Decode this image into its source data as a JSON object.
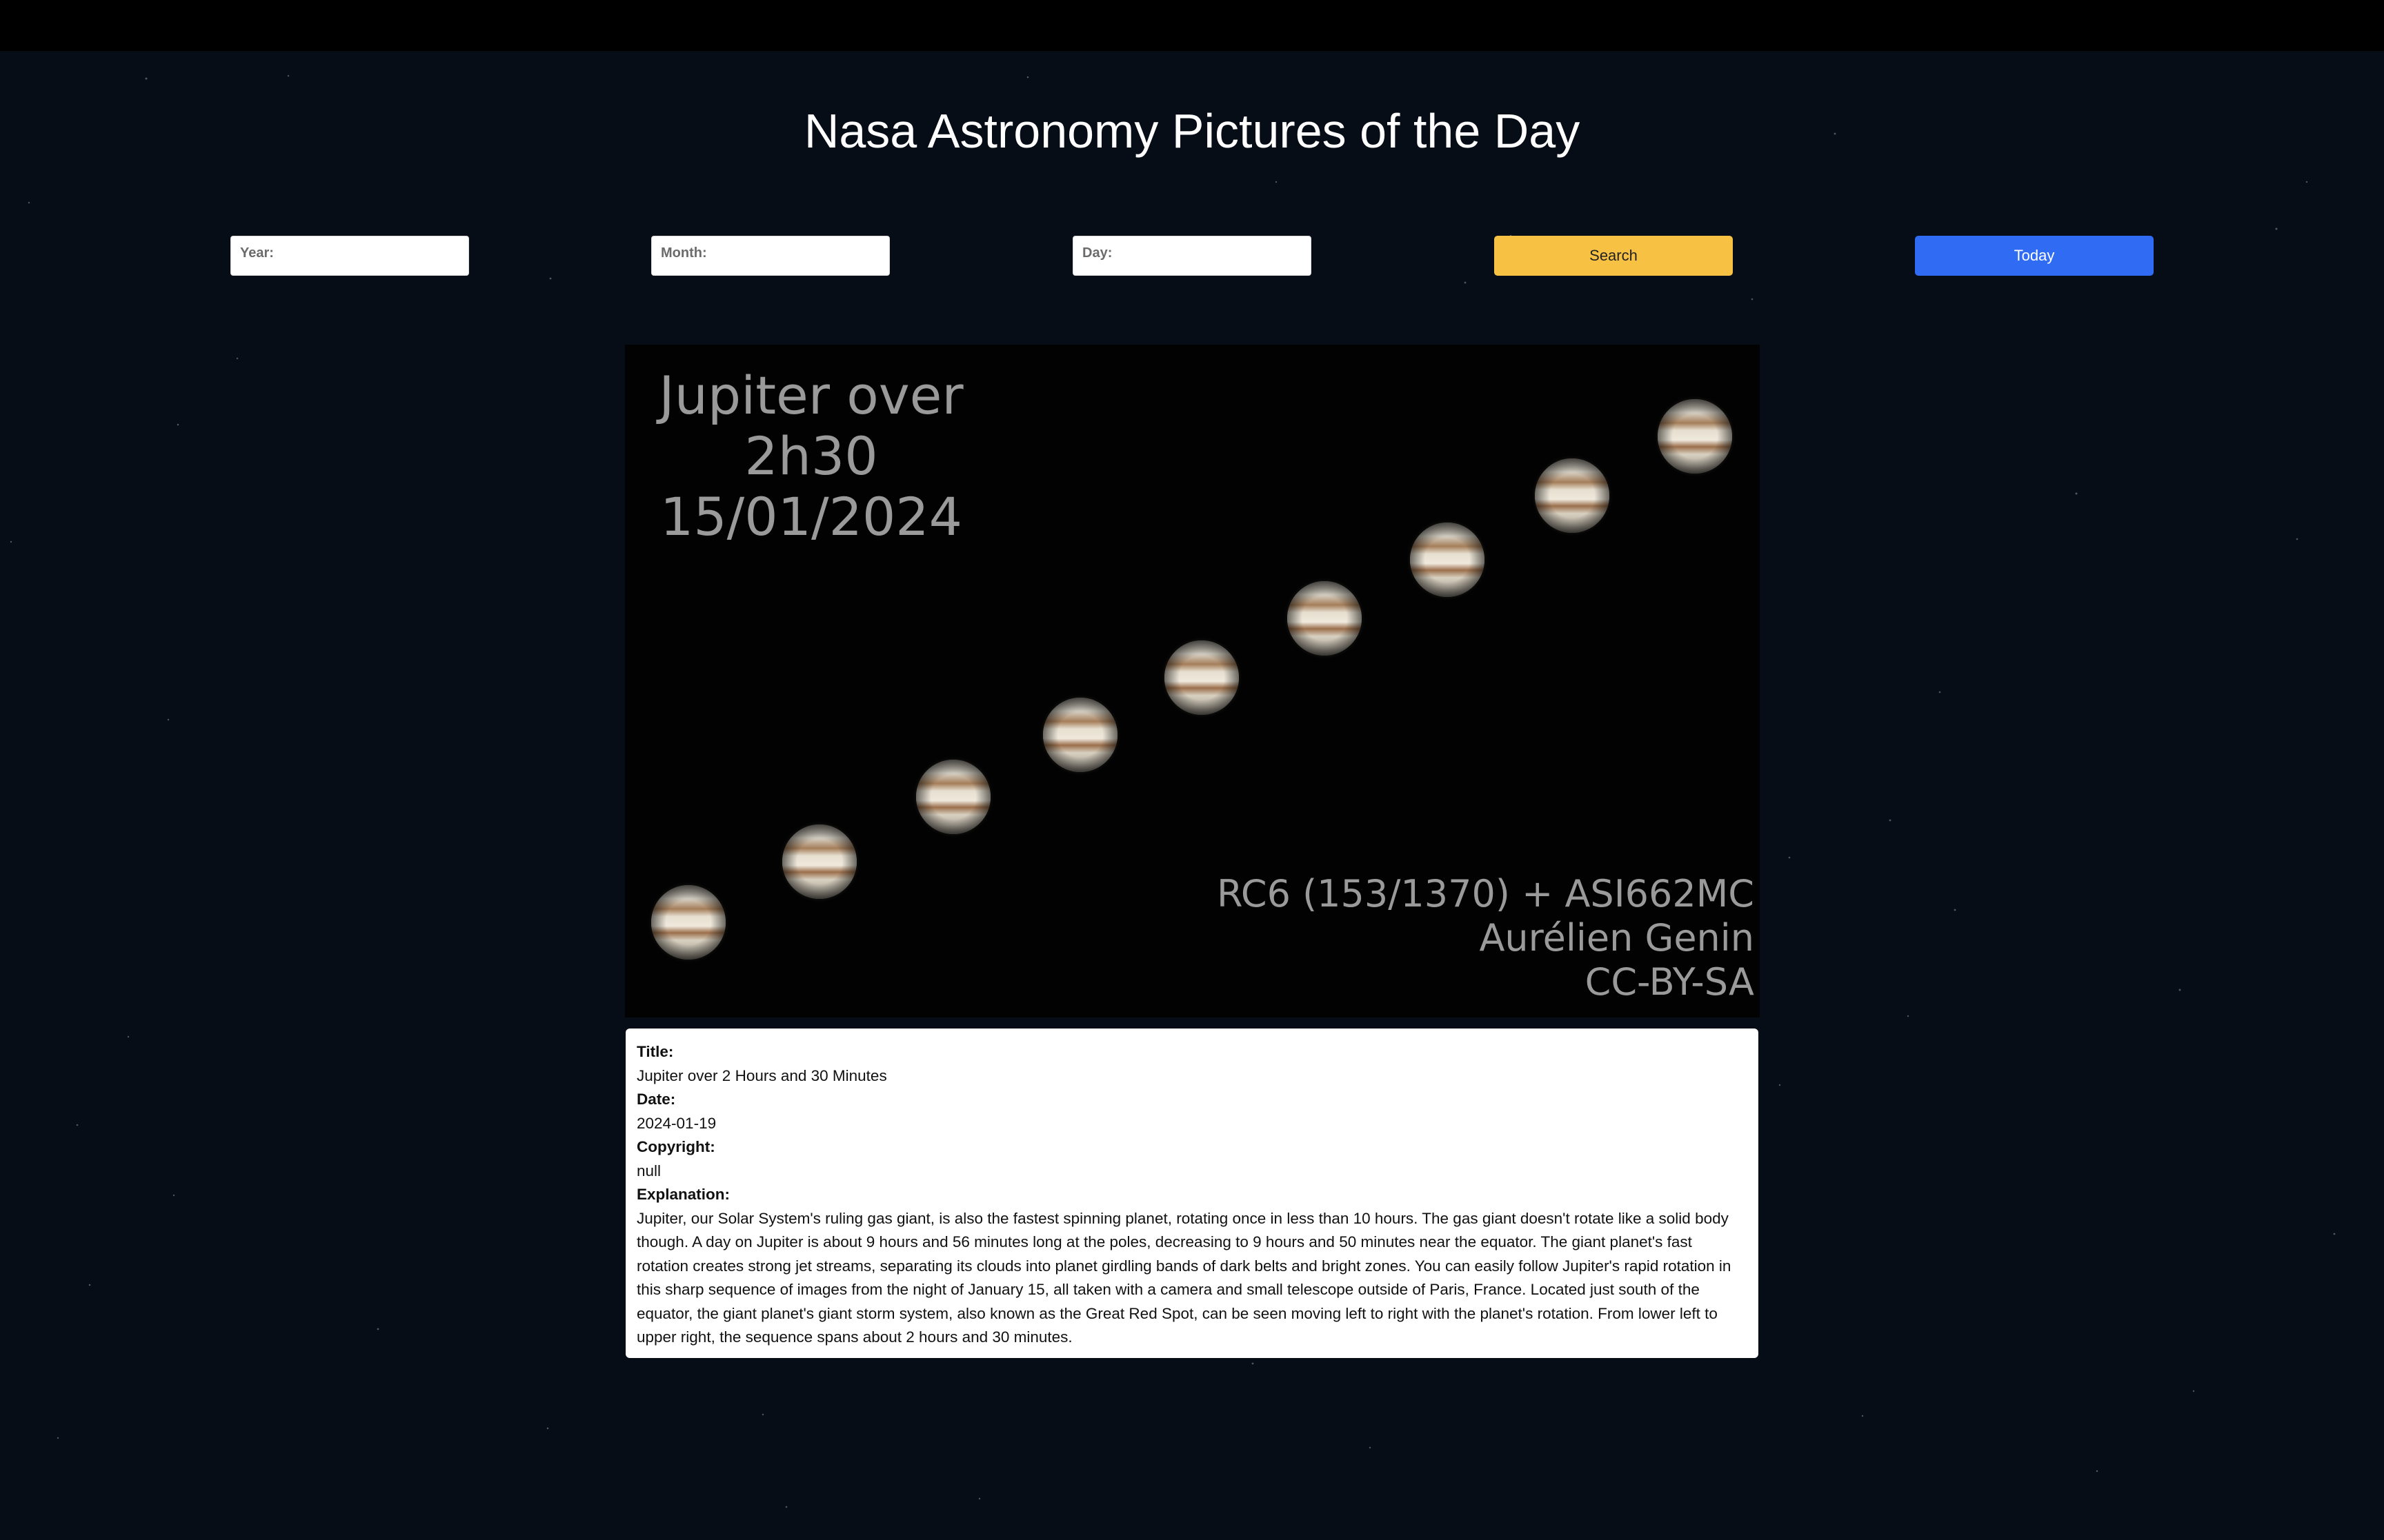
{
  "page": {
    "title": "Nasa Astronomy Pictures of the Day"
  },
  "form": {
    "year_label": "Year:",
    "month_label": "Month:",
    "day_label": "Day:",
    "search_label": "Search",
    "today_label": "Today"
  },
  "image": {
    "overlay_title_line1": "Jupiter over 2h30",
    "overlay_title_line2": "15/01/2024",
    "credit_line1": "RC6 (153/1370) + ASI662MC",
    "credit_line2": "Aurélien Genin",
    "credit_line3": "CC-BY-SA"
  },
  "details": {
    "title_label": "Title:",
    "title": "Jupiter over 2 Hours and 30 Minutes",
    "date_label": "Date:",
    "date": "2024-01-19",
    "copyright_label": "Copyright:",
    "copyright": "null",
    "explanation_label": "Explanation:",
    "explanation": "Jupiter, our Solar System's ruling gas giant, is also the fastest spinning planet, rotating once in less than 10 hours. The gas giant doesn't rotate like a solid body though. A day on Jupiter is about 9 hours and 56 minutes long at the poles, decreasing to 9 hours and 50 minutes near the equator. The giant planet's fast rotation creates strong jet streams, separating its clouds into planet girdling bands of dark belts and bright zones. You can easily follow Jupiter's rapid rotation in this sharp sequence of images from the night of January 15, all taken with a camera and small telescope outside of Paris, France. Located just south of the equator, the giant planet's giant storm system, also known as the Great Red Spot, can be seen moving left to right with the planet's rotation. From lower left to upper right, the sequence spans about 2 hours and 30 minutes."
  },
  "colors": {
    "background": "#060d17",
    "search_button": "#f7c244",
    "today_button": "#2f6cf3"
  }
}
